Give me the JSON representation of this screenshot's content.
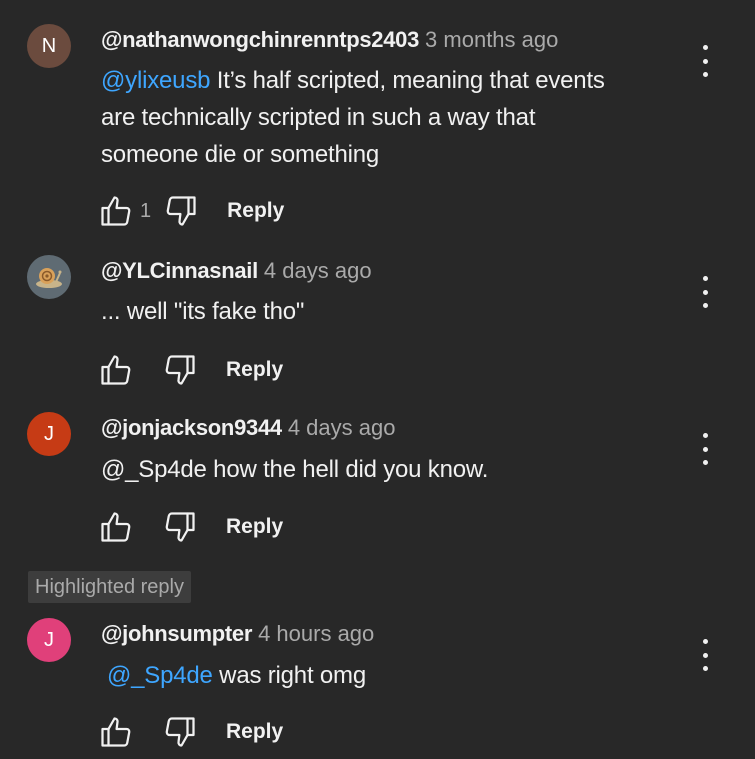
{
  "comments": [
    {
      "avatar_letter": "N",
      "avatar_color": "#6b4b3e",
      "author": "@nathanwongchinrenntps2403",
      "time": "3 months ago",
      "mention": "@ylixeusb",
      "text_line1": " It’s half scripted, meaning that events",
      "text_line2": "are technically scripted in such a way that",
      "text_line3": "someone die or something",
      "likes": "1",
      "reply_label": "Reply"
    },
    {
      "avatar_letter": "",
      "avatar_color": "#5f6b73",
      "author": "@YLCinnasnail",
      "time": "4 days ago",
      "text": "... well \"its fake tho\"",
      "likes": "",
      "reply_label": "Reply"
    },
    {
      "avatar_letter": "J",
      "avatar_color": "#c63b15",
      "author": "@jonjackson9344",
      "time": "4 days ago",
      "text": "@_Sp4de how the hell did you know.",
      "likes": "",
      "reply_label": "Reply"
    },
    {
      "avatar_letter": "J",
      "avatar_color": "#e0407a",
      "author": "@johnsumpter",
      "time": "4 hours ago",
      "mention": "@_Sp4de",
      "text": " was right omg",
      "likes": "",
      "reply_label": "Reply"
    }
  ],
  "highlight_badge": "Highlighted reply",
  "icons": {
    "like": "thumbs-up-icon",
    "dislike": "thumbs-down-icon",
    "more": "more-vert-icon"
  }
}
